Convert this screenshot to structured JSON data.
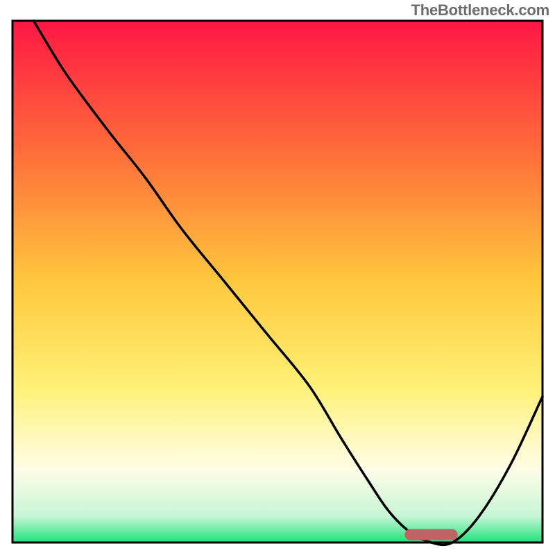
{
  "attribution": "TheBottleneck.com",
  "colors": {
    "border": "#000000",
    "curve": "#000000",
    "indicator": "#c36264",
    "gradient_top": "#ff1744",
    "gradient_mid_upper": "#ff8a3d",
    "gradient_mid": "#ffd740",
    "gradient_mid_lower": "#fff176",
    "gradient_low": "#fffde7",
    "gradient_bottom": "#1de27a"
  },
  "chart_data": {
    "type": "line",
    "title": "",
    "xlabel": "",
    "ylabel": "",
    "xlim": [
      0,
      100
    ],
    "ylim": [
      0,
      100
    ],
    "gradient_stops": [
      {
        "offset": 0.0,
        "color": "#ff1744"
      },
      {
        "offset": 0.25,
        "color": "#ff6d3a"
      },
      {
        "offset": 0.5,
        "color": "#ffc83d"
      },
      {
        "offset": 0.7,
        "color": "#fff176"
      },
      {
        "offset": 0.86,
        "color": "#fffde7"
      },
      {
        "offset": 0.95,
        "color": "#c6f6d5"
      },
      {
        "offset": 1.0,
        "color": "#1de27a"
      }
    ],
    "series": [
      {
        "name": "bottleneck-curve",
        "x": [
          4,
          10,
          18,
          25,
          32,
          40,
          48,
          56,
          62,
          67,
          71,
          75,
          79,
          83,
          88,
          94,
          100
        ],
        "y": [
          100,
          90,
          79,
          70,
          60,
          50,
          40,
          30,
          20,
          12,
          6,
          2,
          0,
          0,
          5,
          15,
          28
        ]
      }
    ],
    "indicator": {
      "x_start": 74,
      "x_end": 84,
      "y": 1.5
    }
  }
}
